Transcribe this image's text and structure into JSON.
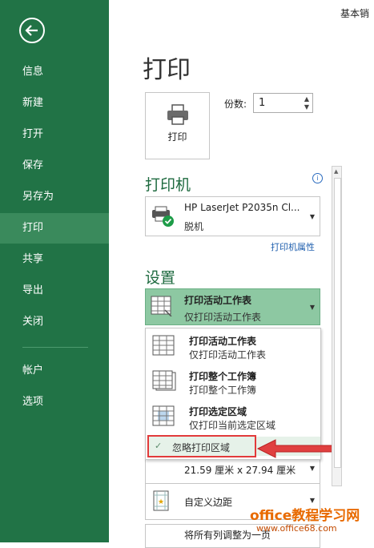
{
  "sidebar": {
    "items": [
      {
        "label": "信息"
      },
      {
        "label": "新建"
      },
      {
        "label": "打开"
      },
      {
        "label": "保存"
      },
      {
        "label": "另存为"
      },
      {
        "label": "打印"
      },
      {
        "label": "共享"
      },
      {
        "label": "导出"
      },
      {
        "label": "关闭"
      },
      {
        "label": "帐户"
      },
      {
        "label": "选项"
      }
    ],
    "active": "打印",
    "bg_color": "#217346"
  },
  "topbar": {
    "right_text": "基本销"
  },
  "print": {
    "title": "打印",
    "button_label": "打印",
    "copies_label": "份数:",
    "copies_value": "1"
  },
  "printer": {
    "section_title": "打印机",
    "name": "HP LaserJet P2035n Cl...",
    "status": "脱机",
    "properties_link": "打印机属性"
  },
  "settings": {
    "section_title": "设置",
    "selected": {
      "title": "打印活动工作表",
      "subtitle": "仅打印活动工作表"
    },
    "menu": [
      {
        "title": "打印活动工作表",
        "subtitle": "仅打印活动工作表"
      },
      {
        "title": "打印整个工作簿",
        "subtitle": "打印整个工作簿"
      },
      {
        "title": "打印选定区域",
        "subtitle": "仅打印当前选定区域"
      }
    ],
    "ignore_print_area": {
      "label": "忽略打印区域",
      "checked": true
    },
    "paper_size": "21.59 厘米 x 27.94 厘米",
    "margins": "自定义边距",
    "scaling": "将所有列调整为一页"
  },
  "watermark": {
    "line1": "office教程学习网",
    "line2": "www.office68.com"
  },
  "colors": {
    "accent": "#217346",
    "highlight_border": "#e23b3b",
    "selected_setting": "#8dc8a2"
  }
}
